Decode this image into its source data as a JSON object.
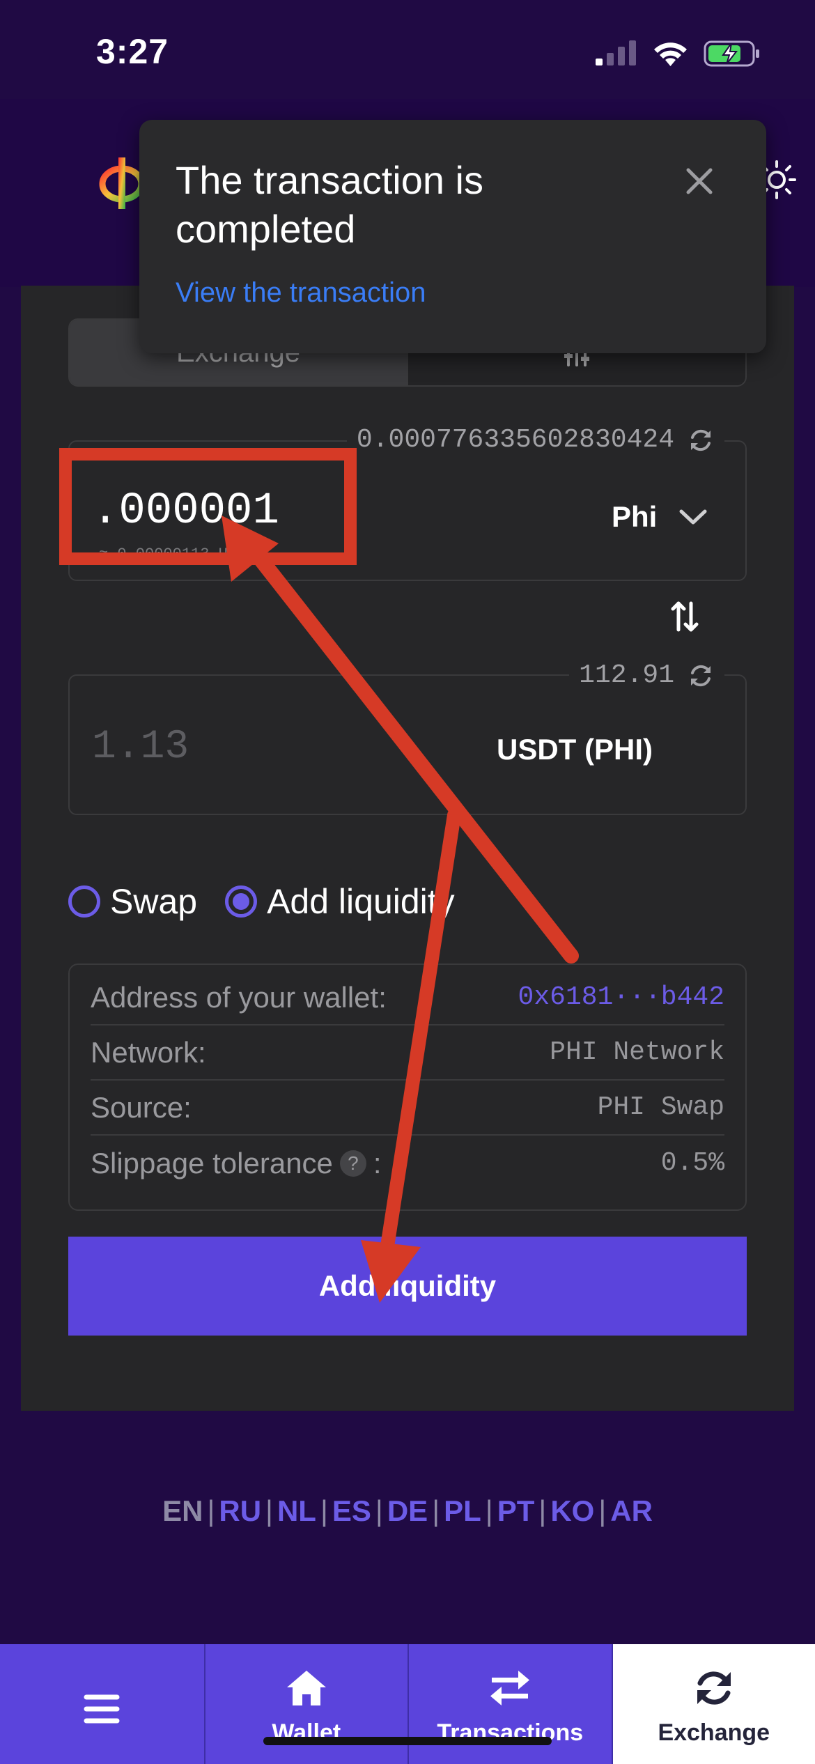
{
  "status_bar": {
    "time": "3:27"
  },
  "toast": {
    "title": "The transaction is completed",
    "link": "View the transaction"
  },
  "tabs": [
    {
      "label": "Exchange"
    }
  ],
  "from": {
    "amount": ".000001",
    "balance": "0.000776335602830424",
    "token": "Phi"
  },
  "to": {
    "amount": "1.13",
    "balance": "112.91",
    "token": "USDT (PHI)"
  },
  "mode": {
    "swap_label": "Swap",
    "add_liquidity_label": "Add liquidity",
    "selected": "Add liquidity"
  },
  "details": {
    "wallet_label": "Address of your wallet:",
    "wallet_value": "0x6181···b442",
    "network_label": "Network:",
    "network_value": "PHI Network",
    "source_label": "Source:",
    "source_value": "PHI Swap",
    "slippage_label": "Slippage tolerance",
    "slippage_help": "?",
    "slippage_colon": ":",
    "slippage_value": "0.5%"
  },
  "action_button": "Add liquidity",
  "languages": [
    "EN",
    "RU",
    "NL",
    "ES",
    "DE",
    "PL",
    "PT",
    "KO",
    "AR"
  ],
  "current_language": "EN",
  "bottom_nav": {
    "wallet": "Wallet",
    "transactions": "Transactions",
    "exchange": "Exchange",
    "active": "Exchange"
  },
  "colors": {
    "background": "#200a44",
    "card": "#262628",
    "accent": "#5b44dc",
    "link": "#3a7df6",
    "annotation": "#d63a26"
  }
}
